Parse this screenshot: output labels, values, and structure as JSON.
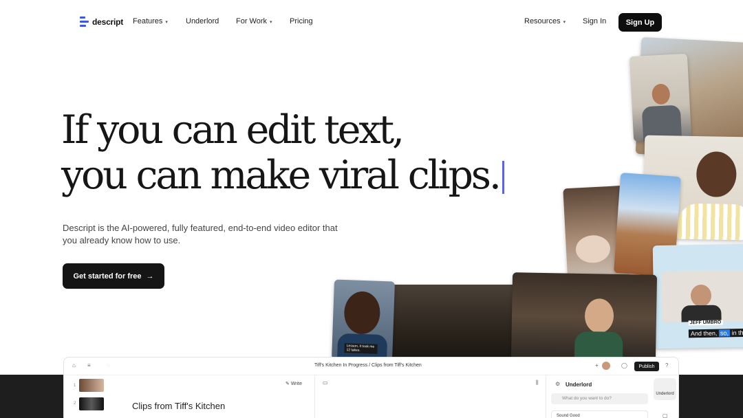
{
  "nav": {
    "logo_text": "descript",
    "features": "Features",
    "underlord": "Underlord",
    "for_work": "For Work",
    "pricing": "Pricing",
    "resources": "Resources",
    "sign_in": "Sign In",
    "sign_up": "Sign Up"
  },
  "hero": {
    "headline_line1": "If you can edit text,",
    "headline_line2": "you can make viral clips.",
    "subtext": "Descript is the AI-powered, fully featured, end-to-end video editor that you already know how to use.",
    "cta": "Get started for free",
    "cta_arrow": "→"
  },
  "collage": {
    "caption_small": "Lesson, it took me 12 takes.",
    "speaker_name": "JEFF UMBRO",
    "caption_prefix": "And then,",
    "caption_highlight": "so,",
    "caption_suffix": "in th"
  },
  "editor": {
    "breadcrumb": "Tiff's Kitchen In Progress  /  Clips from Tiff's Kitchen",
    "publish": "Publish",
    "write": "Write",
    "doc_title": "Clips from Tiff's Kitchen",
    "rows": [
      "1",
      "2"
    ],
    "panel_title": "Underlord",
    "ask_placeholder": "What do you want to do?",
    "sound_item": "Sound Good",
    "side_label": "Underlord"
  },
  "colors": {
    "accent": "#5a64e8",
    "logo_blue": "#3b56ea",
    "button_dark": "#151515",
    "band": "#1e1e1e"
  }
}
